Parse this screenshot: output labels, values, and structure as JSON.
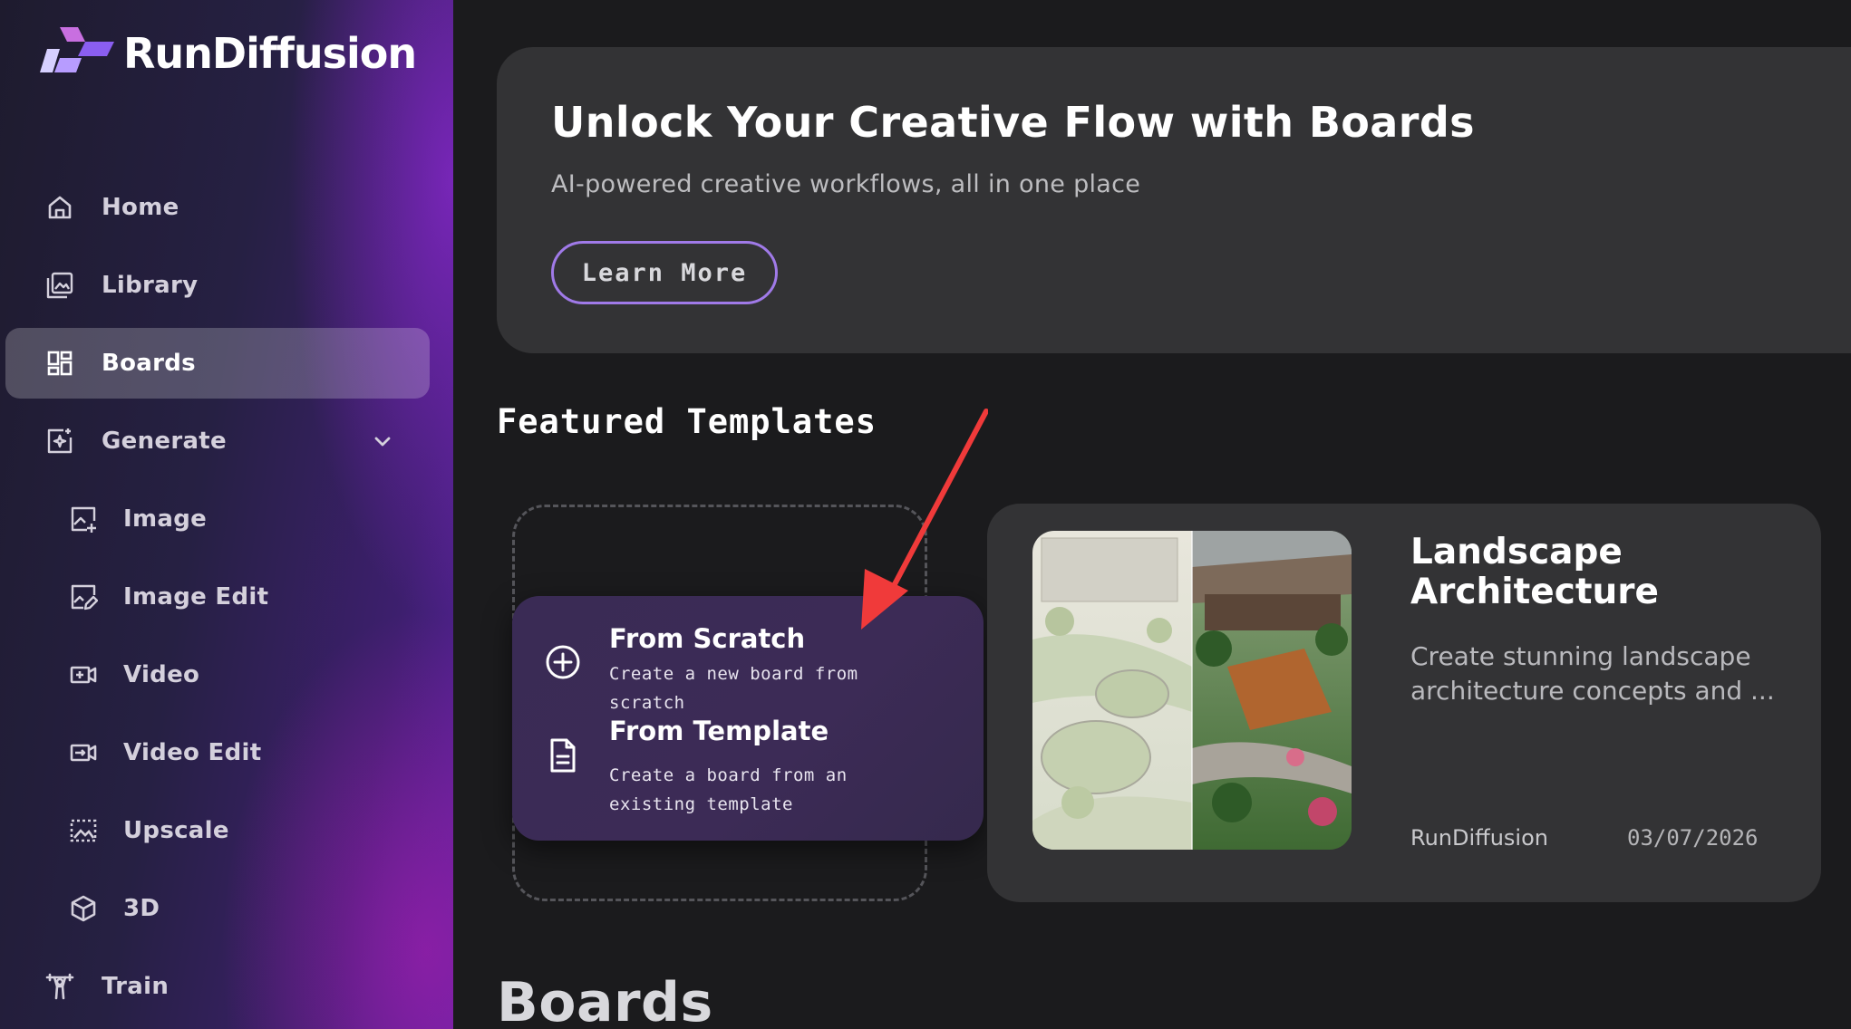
{
  "brand": {
    "name": "RunDiffusion"
  },
  "sidebar": {
    "items": [
      {
        "label": "Home",
        "icon": "home-icon"
      },
      {
        "label": "Library",
        "icon": "library-icon"
      },
      {
        "label": "Boards",
        "icon": "boards-icon",
        "active": true
      },
      {
        "label": "Generate",
        "icon": "generate-icon",
        "expandable": true
      },
      {
        "label": "Image",
        "icon": "image-add-icon"
      },
      {
        "label": "Image Edit",
        "icon": "image-edit-icon"
      },
      {
        "label": "Video",
        "icon": "video-icon"
      },
      {
        "label": "Video Edit",
        "icon": "video-edit-icon"
      },
      {
        "label": "Upscale",
        "icon": "upscale-icon"
      },
      {
        "label": "3D",
        "icon": "cube-icon"
      },
      {
        "label": "Train",
        "icon": "train-icon"
      }
    ]
  },
  "hero": {
    "title": "Unlock Your Creative Flow with Boards",
    "subtitle": "AI-powered creative workflows, all in one place",
    "button_label": "Learn More"
  },
  "featured": {
    "title": "Featured Templates",
    "new_board_menu": {
      "scratch": {
        "title": "From Scratch",
        "desc": "Create a new board from scratch"
      },
      "template": {
        "title": "From Template",
        "desc": "Create a board from an existing template"
      }
    },
    "template_card": {
      "title": "Landscape Architecture",
      "desc": "Create stunning landscape architecture concepts and ...",
      "author": "RunDiffusion",
      "date": "03/07/2026"
    }
  },
  "boards_section": {
    "title": "Boards"
  },
  "colors": {
    "accent": "#a07ae8",
    "annotation_arrow": "#f03a3a",
    "background": "#1b1b1d",
    "card": "#333335"
  }
}
